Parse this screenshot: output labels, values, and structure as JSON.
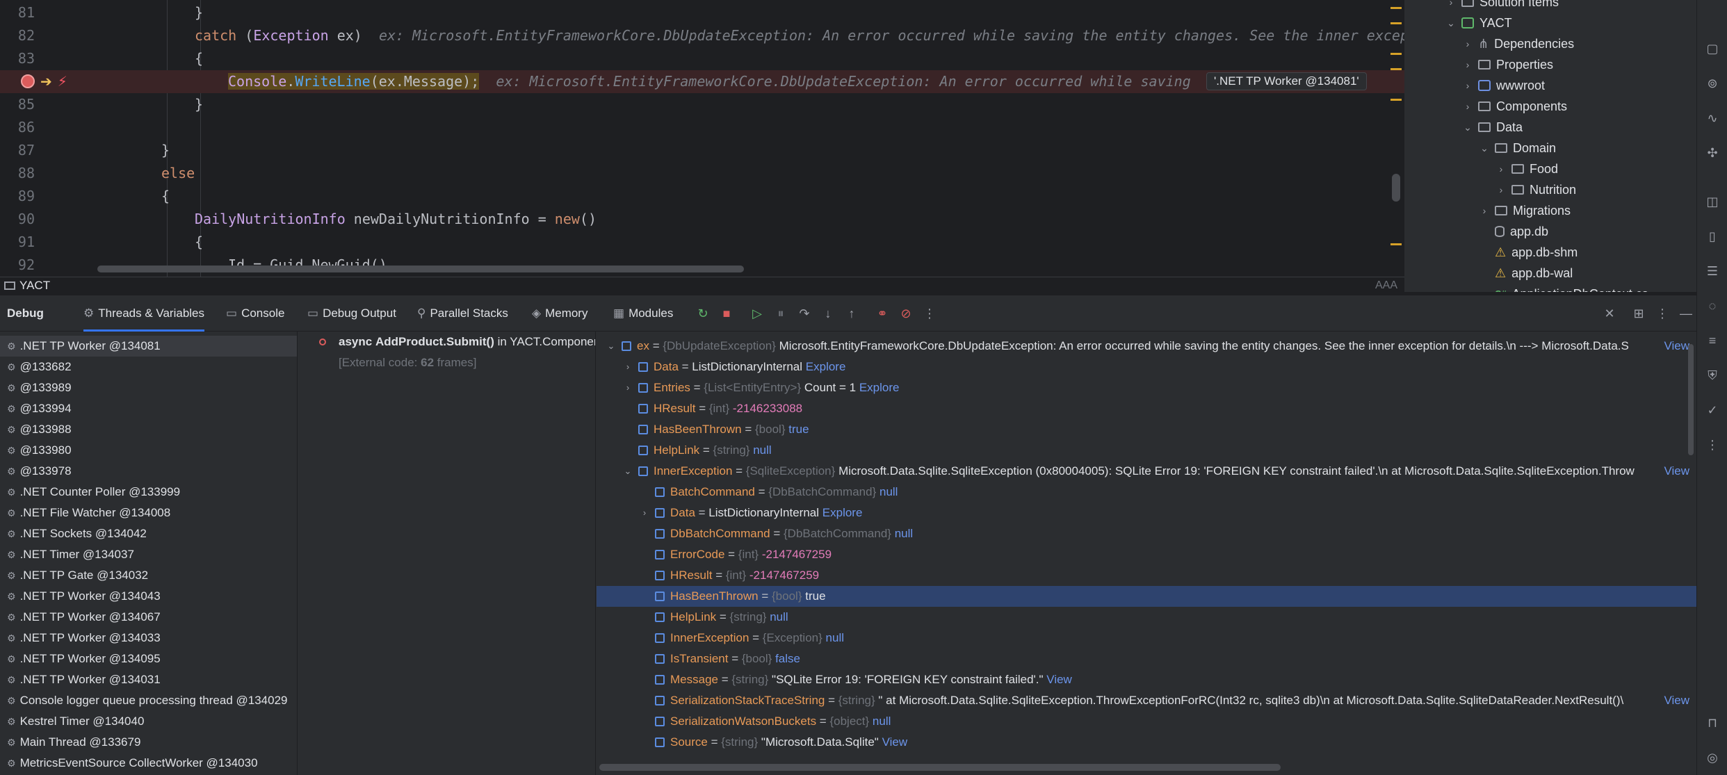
{
  "editor": {
    "lines": [
      {
        "num": "81",
        "indent": 280,
        "parts": [
          {
            "c": "",
            "t": "}"
          }
        ]
      },
      {
        "num": "82",
        "indent": 280,
        "parts": [
          {
            "c": "kw",
            "t": "catch"
          },
          {
            "c": "",
            "t": " ("
          },
          {
            "c": "cls",
            "t": "Exception"
          },
          {
            "c": "",
            "t": " ex)  "
          },
          {
            "c": "hint",
            "t": "ex: Microsoft.EntityFrameworkCore.DbUpdateException: An error occurred while saving the entity changes. See the inner excep"
          }
        ]
      },
      {
        "num": "83",
        "indent": 280,
        "parts": [
          {
            "c": "",
            "t": "{"
          }
        ]
      },
      {
        "num": "84",
        "indent": 328,
        "parts": [
          {
            "c": "cls",
            "t": "Console"
          },
          {
            "c": "",
            "t": "."
          },
          {
            "c": "fn",
            "t": "WriteLine"
          },
          {
            "c": "",
            "t": "(ex.Message);"
          },
          {
            "c": "",
            "t": "  "
          },
          {
            "c": "hint",
            "t": "ex: Microsoft.EntityFrameworkCore.DbUpdateException: An error occurred while saving"
          }
        ]
      },
      {
        "num": "85",
        "indent": 280,
        "parts": [
          {
            "c": "",
            "t": "}"
          }
        ]
      },
      {
        "num": "86",
        "indent": 280,
        "parts": []
      },
      {
        "num": "87",
        "indent": 232,
        "parts": [
          {
            "c": "",
            "t": "}"
          }
        ]
      },
      {
        "num": "88",
        "indent": 232,
        "parts": [
          {
            "c": "kw",
            "t": "else"
          }
        ]
      },
      {
        "num": "89",
        "indent": 232,
        "parts": [
          {
            "c": "",
            "t": "{"
          }
        ]
      },
      {
        "num": "90",
        "indent": 280,
        "parts": [
          {
            "c": "cls",
            "t": "DailyNutritionInfo"
          },
          {
            "c": "",
            "t": " newDailyNutritionInfo = "
          },
          {
            "c": "kw",
            "t": "new"
          },
          {
            "c": "",
            "t": "()"
          }
        ]
      },
      {
        "num": "91",
        "indent": 280,
        "parts": [
          {
            "c": "",
            "t": "{"
          }
        ]
      },
      {
        "num": "92",
        "indent": 328,
        "parts": [
          {
            "c": "",
            "t": "Id = Guid.NewGuid(),"
          }
        ]
      }
    ],
    "thread_chip": "'.NET TP Worker @134081'",
    "breadcrumb": "YACT",
    "reader_mode": "AAA"
  },
  "tree": [
    {
      "label": "Solution Items",
      "depth": 1,
      "chev": "›",
      "icon": "folder"
    },
    {
      "label": "YACT",
      "depth": 1,
      "chev": "⌄",
      "icon": "proj"
    },
    {
      "label": "Dependencies",
      "depth": 2,
      "chev": "›",
      "icon": "dep"
    },
    {
      "label": "Properties",
      "depth": 2,
      "chev": "›",
      "icon": "folder"
    },
    {
      "label": "wwwroot",
      "depth": 2,
      "chev": "›",
      "icon": "glob"
    },
    {
      "label": "Components",
      "depth": 2,
      "chev": "›",
      "icon": "folder"
    },
    {
      "label": "Data",
      "depth": 2,
      "chev": "⌄",
      "icon": "folder"
    },
    {
      "label": "Domain",
      "depth": 3,
      "chev": "⌄",
      "icon": "folder"
    },
    {
      "label": "Food",
      "depth": 4,
      "chev": "›",
      "icon": "folder"
    },
    {
      "label": "Nutrition",
      "depth": 4,
      "chev": "›",
      "icon": "folder"
    },
    {
      "label": "Migrations",
      "depth": 3,
      "chev": "›",
      "icon": "folder"
    },
    {
      "label": "app.db",
      "depth": 3,
      "chev": "",
      "icon": "db"
    },
    {
      "label": "app.db-shm",
      "depth": 3,
      "chev": "",
      "icon": "warn"
    },
    {
      "label": "app.db-wal",
      "depth": 3,
      "chev": "",
      "icon": "warn"
    },
    {
      "label": "ApplicationDbContext.cs",
      "depth": 3,
      "chev": "",
      "icon": "cs"
    }
  ],
  "debug": {
    "tabs": [
      {
        "label": "Debug",
        "icon": "",
        "bold": true
      },
      {
        "label": "Threads & Variables",
        "icon": "⚙",
        "active": true
      },
      {
        "label": "Console",
        "icon": "▭"
      },
      {
        "label": "Debug Output",
        "icon": "▭"
      },
      {
        "label": "Parallel Stacks",
        "icon": "⚲"
      },
      {
        "label": "Memory",
        "icon": "◈"
      },
      {
        "label": "Modules",
        "icon": "▦"
      }
    ],
    "threads": [
      {
        "label": ".NET TP Worker @134081",
        "selected": true
      },
      {
        "label": "@133682"
      },
      {
        "label": "@133989"
      },
      {
        "label": "@133994"
      },
      {
        "label": "@133988"
      },
      {
        "label": "@133980"
      },
      {
        "label": "@133978"
      },
      {
        "label": ".NET Counter Poller @133999"
      },
      {
        "label": ".NET File Watcher @134008"
      },
      {
        "label": ".NET Sockets @134042"
      },
      {
        "label": ".NET Timer @134037"
      },
      {
        "label": ".NET TP Gate @134032"
      },
      {
        "label": ".NET TP Worker @134043"
      },
      {
        "label": ".NET TP Worker @134067"
      },
      {
        "label": ".NET TP Worker @134033"
      },
      {
        "label": ".NET TP Worker @134095"
      },
      {
        "label": ".NET TP Worker @134031"
      },
      {
        "label": "Console logger queue processing thread @134029"
      },
      {
        "label": "Kestrel Timer @134040"
      },
      {
        "label": "Main Thread @133679"
      },
      {
        "label": "MetricsEventSource CollectWorker @134030"
      }
    ],
    "frames": {
      "async_kw": "async",
      "method": "AddProduct.Submit()",
      "location": "in YACT.Components.",
      "external_prefix": "[External code: ",
      "external_count": "62",
      "external_suffix": " frames]"
    },
    "variables": [
      {
        "depth": 0,
        "chev": "⌄",
        "name": "ex",
        "type": "{DbUpdateException}",
        "value": "Microsoft.EntityFrameworkCore.DbUpdateException: An error occurred while saving the entity changes. See the inner exception for details.\\n ---> Microsoft.Data.S",
        "vclass": "vstr",
        "view": "View"
      },
      {
        "depth": 1,
        "chev": "›",
        "name": "Data",
        "type": "",
        "value": "ListDictionaryInternal",
        "vclass": "vstr",
        "link": "Explore"
      },
      {
        "depth": 1,
        "chev": "›",
        "name": "Entries",
        "type": "{List<EntityEntry>}",
        "value": "Count = 1",
        "vclass": "vstr",
        "link": "Explore"
      },
      {
        "depth": 1,
        "chev": "",
        "name": "HResult",
        "type": "{int}",
        "value": "-2146233088",
        "vclass": "vnum"
      },
      {
        "depth": 1,
        "chev": "",
        "name": "HasBeenThrown",
        "type": "{bool}",
        "value": "true",
        "vclass": "vkw"
      },
      {
        "depth": 1,
        "chev": "",
        "name": "HelpLink",
        "type": "{string}",
        "value": "null",
        "vclass": "vkw"
      },
      {
        "depth": 1,
        "chev": "⌄",
        "name": "InnerException",
        "type": "{SqliteException}",
        "value": "Microsoft.Data.Sqlite.SqliteException (0x80004005): SQLite Error 19: 'FOREIGN KEY constraint failed'.\\n   at Microsoft.Data.Sqlite.SqliteException.Throw",
        "vclass": "vstr",
        "view": "View"
      },
      {
        "depth": 2,
        "chev": "",
        "name": "BatchCommand",
        "type": "{DbBatchCommand}",
        "value": "null",
        "vclass": "vkw"
      },
      {
        "depth": 2,
        "chev": "›",
        "name": "Data",
        "type": "",
        "value": "ListDictionaryInternal",
        "vclass": "vstr",
        "link": "Explore"
      },
      {
        "depth": 2,
        "chev": "",
        "name": "DbBatchCommand",
        "type": "{DbBatchCommand}",
        "value": "null",
        "vclass": "vkw"
      },
      {
        "depth": 2,
        "chev": "",
        "name": "ErrorCode",
        "type": "{int}",
        "value": "-2147467259",
        "vclass": "vnum"
      },
      {
        "depth": 2,
        "chev": "",
        "name": "HResult",
        "type": "{int}",
        "value": "-2147467259",
        "vclass": "vnum"
      },
      {
        "depth": 2,
        "chev": "",
        "name": "HasBeenThrown",
        "type": "{bool}",
        "value": "true",
        "vclass": "vstr",
        "selected": true
      },
      {
        "depth": 2,
        "chev": "",
        "name": "HelpLink",
        "type": "{string}",
        "value": "null",
        "vclass": "vkw"
      },
      {
        "depth": 2,
        "chev": "",
        "name": "InnerException",
        "type": "{Exception}",
        "value": "null",
        "vclass": "vkw"
      },
      {
        "depth": 2,
        "chev": "",
        "name": "IsTransient",
        "type": "{bool}",
        "value": "false",
        "vclass": "vkw"
      },
      {
        "depth": 2,
        "chev": "",
        "name": "Message",
        "type": "{string}",
        "value": "\"SQLite Error 19: 'FOREIGN KEY constraint failed'.\"",
        "vclass": "vstr",
        "link": "View"
      },
      {
        "depth": 2,
        "chev": "",
        "name": "SerializationStackTraceString",
        "type": "{string}",
        "value": "\"   at Microsoft.Data.Sqlite.SqliteException.ThrowExceptionForRC(Int32 rc, sqlite3 db)\\n   at Microsoft.Data.Sqlite.SqliteDataReader.NextResult()\\",
        "vclass": "vstr",
        "view": "View"
      },
      {
        "depth": 2,
        "chev": "",
        "name": "SerializationWatsonBuckets",
        "type": "{object}",
        "value": "null",
        "vclass": "vkw"
      },
      {
        "depth": 2,
        "chev": "",
        "name": "Source",
        "type": "{string}",
        "value": "\"Microsoft.Data.Sqlite\"",
        "vclass": "vstr",
        "link": "View"
      }
    ]
  }
}
